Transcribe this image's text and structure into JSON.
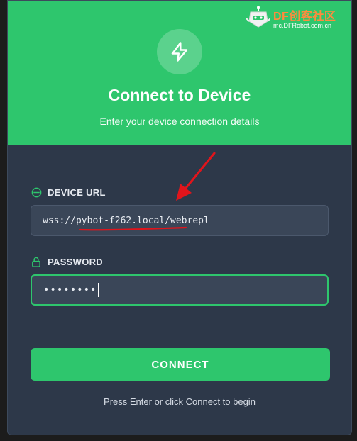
{
  "watermark": {
    "brand": "DF创客社区",
    "url": "mc.DFRobot.com.cn"
  },
  "header": {
    "icon": "bolt-icon",
    "title": "Connect to Device",
    "subtitle": "Enter your device connection details"
  },
  "form": {
    "url_label": "DEVICE URL",
    "url_icon": "minus-circle-icon",
    "url_value": "wss://pybot-f262.local/webrepl",
    "password_label": "PASSWORD",
    "password_icon": "lock-icon",
    "password_value": "••••••••",
    "connect_label": "CONNECT",
    "hint": "Press Enter or click Connect to begin"
  },
  "colors": {
    "accent": "#2ec66d",
    "card_bg": "#2d3849",
    "input_bg": "#3a4658",
    "annotation": "#e1141b",
    "watermark_orange": "#ff8b3d"
  }
}
